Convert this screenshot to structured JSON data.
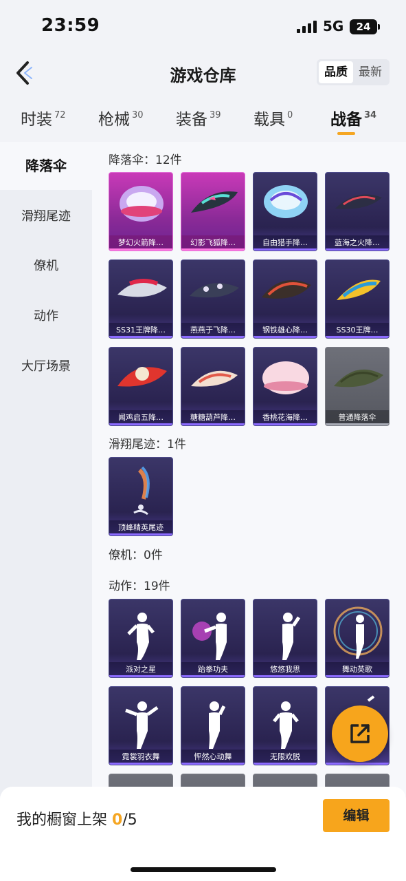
{
  "status_bar": {
    "time": "23:59",
    "network": "5G",
    "battery": "24"
  },
  "header": {
    "title": "游戏仓库",
    "sort_options": [
      "品质",
      "最新"
    ],
    "active_sort": "品质"
  },
  "tabs": [
    {
      "label": "时装",
      "count": "72"
    },
    {
      "label": "枪械",
      "count": "30"
    },
    {
      "label": "装备",
      "count": "39"
    },
    {
      "label": "载具",
      "count": "0"
    },
    {
      "label": "战备",
      "count": "34"
    }
  ],
  "active_tab": "战备",
  "sidebar": {
    "items": [
      "降落伞",
      "滑翔尾迹",
      "僚机",
      "动作",
      "大厅场景"
    ],
    "active": "降落伞"
  },
  "sections": {
    "parachute": {
      "title": "降落伞：12件",
      "items": [
        "梦幻火箭降…",
        "幻影飞狐降…",
        "自由猎手降…",
        "蓝海之火降…",
        "SS31王牌降…",
        "燕燕于飞降…",
        "钢铁雄心降…",
        "SS30王牌…",
        "闻鸡启五降…",
        "糖糖葫芦降…",
        "香桃花海降…",
        "普通降落伞"
      ]
    },
    "glide_trail": {
      "title": "滑翔尾迹：1件",
      "items": [
        "顶峰精英尾迹"
      ]
    },
    "wingman": {
      "title": "僚机：0件"
    },
    "emote": {
      "title": "动作：19件",
      "items": [
        "派对之星",
        "跆拳功夫",
        "悠悠我思",
        "舞动英歌",
        "霓裳羽衣舞",
        "怦然心动舞",
        "无限欢脱"
      ]
    }
  },
  "bottom": {
    "showcase_label": "我的橱窗上架",
    "showcase_current": "0",
    "showcase_total": "/5",
    "edit_label": "编辑"
  },
  "colors": {
    "accent": "#f7a51c",
    "card_purple": "#2a2350",
    "card_pink": "#c93ab8",
    "card_grey": "#5d5f67"
  }
}
